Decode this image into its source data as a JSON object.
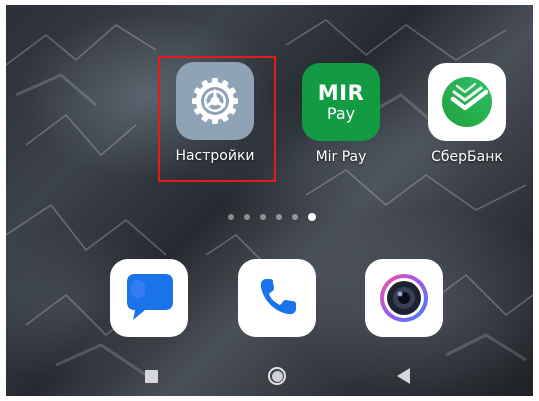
{
  "home_screen": {
    "apps": [
      {
        "id": "settings",
        "label": "Настройки",
        "icon": "gear-icon",
        "color": "#8fa3b6"
      },
      {
        "id": "mirpay",
        "label": "Mir Pay",
        "icon": "mir-pay-icon",
        "color": "#139b44",
        "logo_text": "MIR",
        "logo_subtext": "Pay"
      },
      {
        "id": "sber",
        "label": "СберБанк",
        "icon": "sberbank-icon",
        "color": "#21a038"
      }
    ],
    "highlight_color": "#e31b1b",
    "page_indicator": {
      "total": 6,
      "active": 6
    },
    "dock": [
      {
        "id": "messages",
        "icon": "messages-icon",
        "color": "#1a73e8"
      },
      {
        "id": "phone",
        "icon": "phone-icon",
        "color": "#1a73e8"
      },
      {
        "id": "camera",
        "icon": "camera-icon",
        "color": "#7b4dd8"
      }
    ]
  },
  "nav_bar": {
    "buttons": [
      {
        "id": "recents",
        "icon": "square-icon"
      },
      {
        "id": "home",
        "icon": "circle-icon"
      },
      {
        "id": "back",
        "icon": "back-triangle-icon"
      }
    ]
  }
}
